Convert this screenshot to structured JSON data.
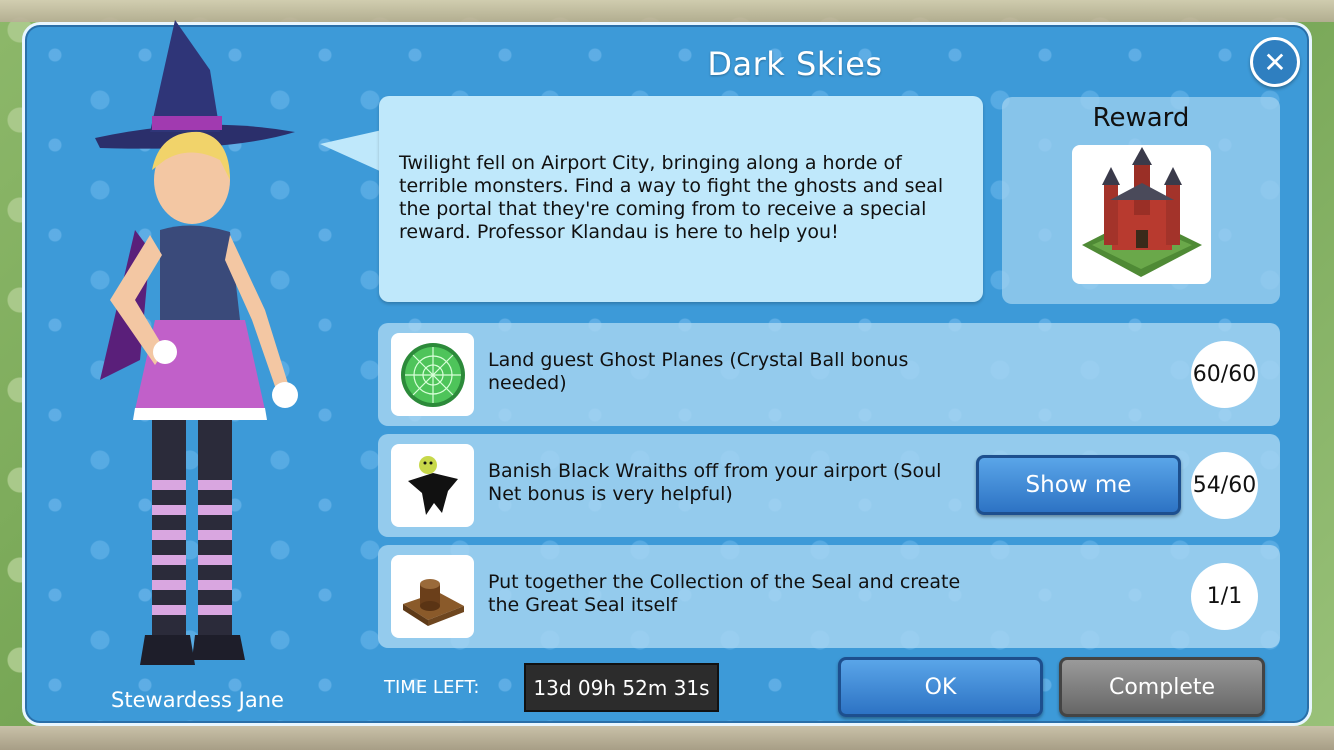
{
  "dialog": {
    "title": "Dark Skies",
    "close_icon": "close-icon",
    "character_name": "Stewardess Jane",
    "message": "Twilight fell on Airport City, bringing along a horde of terrible monsters. Find a way to fight the ghosts and seal the portal that they're coming from to receive a special reward. Professor Klandau is here to help you!"
  },
  "reward": {
    "title": "Reward",
    "icon": "castle-icon"
  },
  "tasks": [
    {
      "icon": "radar-icon",
      "text": "Land guest Ghost Planes (Crystal Ball bonus needed)",
      "count": "60/60"
    },
    {
      "icon": "wraith-icon",
      "text": "Banish Black Wraiths off from your airport (Soul Net bonus is very helpful)",
      "count": "54/60",
      "action_label": "Show me"
    },
    {
      "icon": "seal-icon",
      "text": "Put together the Collection of the Seal and create the Great Seal itself",
      "count": "1/1"
    }
  ],
  "footer": {
    "time_label": "TIME LEFT:",
    "time_value": "13d 09h 52m 31s",
    "ok_label": "OK",
    "complete_label": "Complete"
  },
  "colors": {
    "panel": "#3d9ad8",
    "bubble": "#bfe8fb",
    "primary_button": "#2d73c4",
    "disabled_button": "#666666"
  }
}
